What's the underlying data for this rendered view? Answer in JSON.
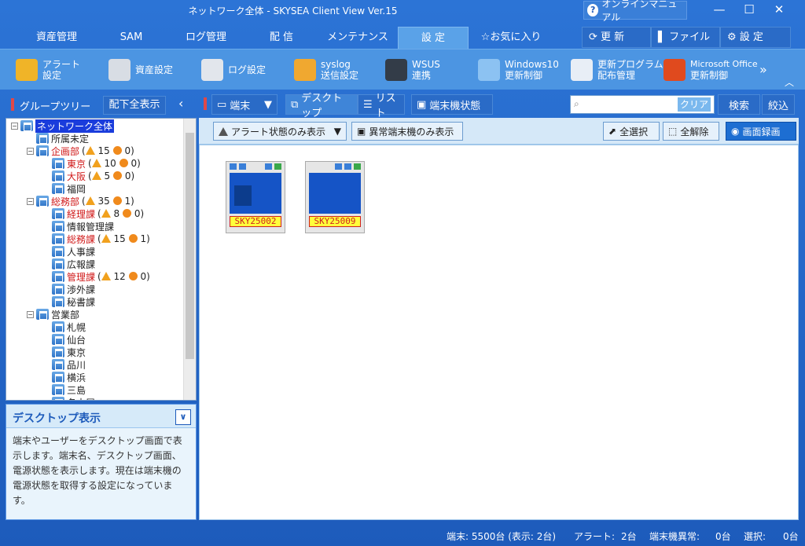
{
  "window": {
    "title": "ネットワーク全体 - SKYSEA Client View Ver.15",
    "help_label": "オンラインマニュアル"
  },
  "menu": {
    "tabs": [
      "資産管理",
      "SAM",
      "ログ管理",
      "配 信",
      "メンテナンス",
      "設 定",
      "お気に入り"
    ],
    "active": "設 定",
    "right": [
      "更 新",
      "ファイル",
      "設 定"
    ]
  },
  "ribbon": [
    {
      "l1": "アラート",
      "l2": "設定",
      "icon": "alert-settings-icon"
    },
    {
      "l1": "資産設定",
      "l2": "",
      "icon": "asset-settings-icon"
    },
    {
      "l1": "ログ設定",
      "l2": "",
      "icon": "log-settings-icon"
    },
    {
      "l1": "syslog",
      "l2": "送信設定",
      "icon": "syslog-icon"
    },
    {
      "l1": "WSUS",
      "l2": "連携",
      "icon": "wsus-icon"
    },
    {
      "l1": "Windows10",
      "l2": "更新制御",
      "icon": "windows10-icon"
    },
    {
      "l1": "更新プログラム",
      "l2": "配布管理",
      "icon": "update-program-icon"
    },
    {
      "l1": "Microsoft Office",
      "l2": "更新制御",
      "icon": "office-icon"
    }
  ],
  "group_pane": {
    "title": "グループツリー",
    "expand_all": "配下全表示"
  },
  "tree": [
    {
      "label": "ネットワーク全体",
      "level": 0,
      "exp": "−",
      "selected": true
    },
    {
      "label": "所属未定",
      "level": 1
    },
    {
      "label": "企画部",
      "level": 1,
      "exp": "−",
      "red": true,
      "a": "15",
      "b": "0"
    },
    {
      "label": "東京",
      "level": 2,
      "red": true,
      "a": "10",
      "b": "0"
    },
    {
      "label": "大阪",
      "level": 2,
      "red": true,
      "a": "5",
      "b": "0"
    },
    {
      "label": "福岡",
      "level": 2
    },
    {
      "label": "総務部",
      "level": 1,
      "exp": "−",
      "red": true,
      "a": "35",
      "b": "1"
    },
    {
      "label": "経理課",
      "level": 2,
      "red": true,
      "a": "8",
      "b": "0"
    },
    {
      "label": "情報管理課",
      "level": 2
    },
    {
      "label": "総務課",
      "level": 2,
      "red": true,
      "a": "15",
      "b": "1"
    },
    {
      "label": "人事課",
      "level": 2
    },
    {
      "label": "広報課",
      "level": 2
    },
    {
      "label": "管理課",
      "level": 2,
      "red": true,
      "a": "12",
      "b": "0"
    },
    {
      "label": "渉外課",
      "level": 2
    },
    {
      "label": "秘書課",
      "level": 2
    },
    {
      "label": "営業部",
      "level": 1,
      "exp": "−"
    },
    {
      "label": "札幌",
      "level": 2
    },
    {
      "label": "仙台",
      "level": 2
    },
    {
      "label": "東京",
      "level": 2
    },
    {
      "label": "品川",
      "level": 2
    },
    {
      "label": "横浜",
      "level": 2
    },
    {
      "label": "三島",
      "level": 2
    },
    {
      "label": "名古屋",
      "level": 2
    }
  ],
  "desc": {
    "title": "デスクトップ表示",
    "body": "端末やユーザーをデスクトップ画面で表示します。端末名、デスクトップ画面、電源状態を表示します。現在は端末機の電源状態を取得する設定になっています。"
  },
  "toolbar": {
    "terminal": "端末",
    "desktop": "デスクトップ",
    "list": "リスト",
    "terminal_state": "端末機状態",
    "clear": "クリア",
    "search": "検索",
    "filter": "絞込",
    "search_placeholder": ""
  },
  "toolbar2": {
    "alert_only": "アラート状態のみ表示",
    "abnormal_only": "異常端末機のみ表示",
    "select_all": "全選択",
    "deselect_all": "全解除",
    "record": "画面録画"
  },
  "terminals": [
    "SKY25002",
    "SKY25009"
  ],
  "status": {
    "terminals": "端末: 5500台 (表示: 2台)",
    "alert": "アラート:",
    "alert_v": "2台",
    "abnormal": "端末機異常:",
    "abnormal_v": "0台",
    "selected": "選択:",
    "selected_v": "0台"
  }
}
